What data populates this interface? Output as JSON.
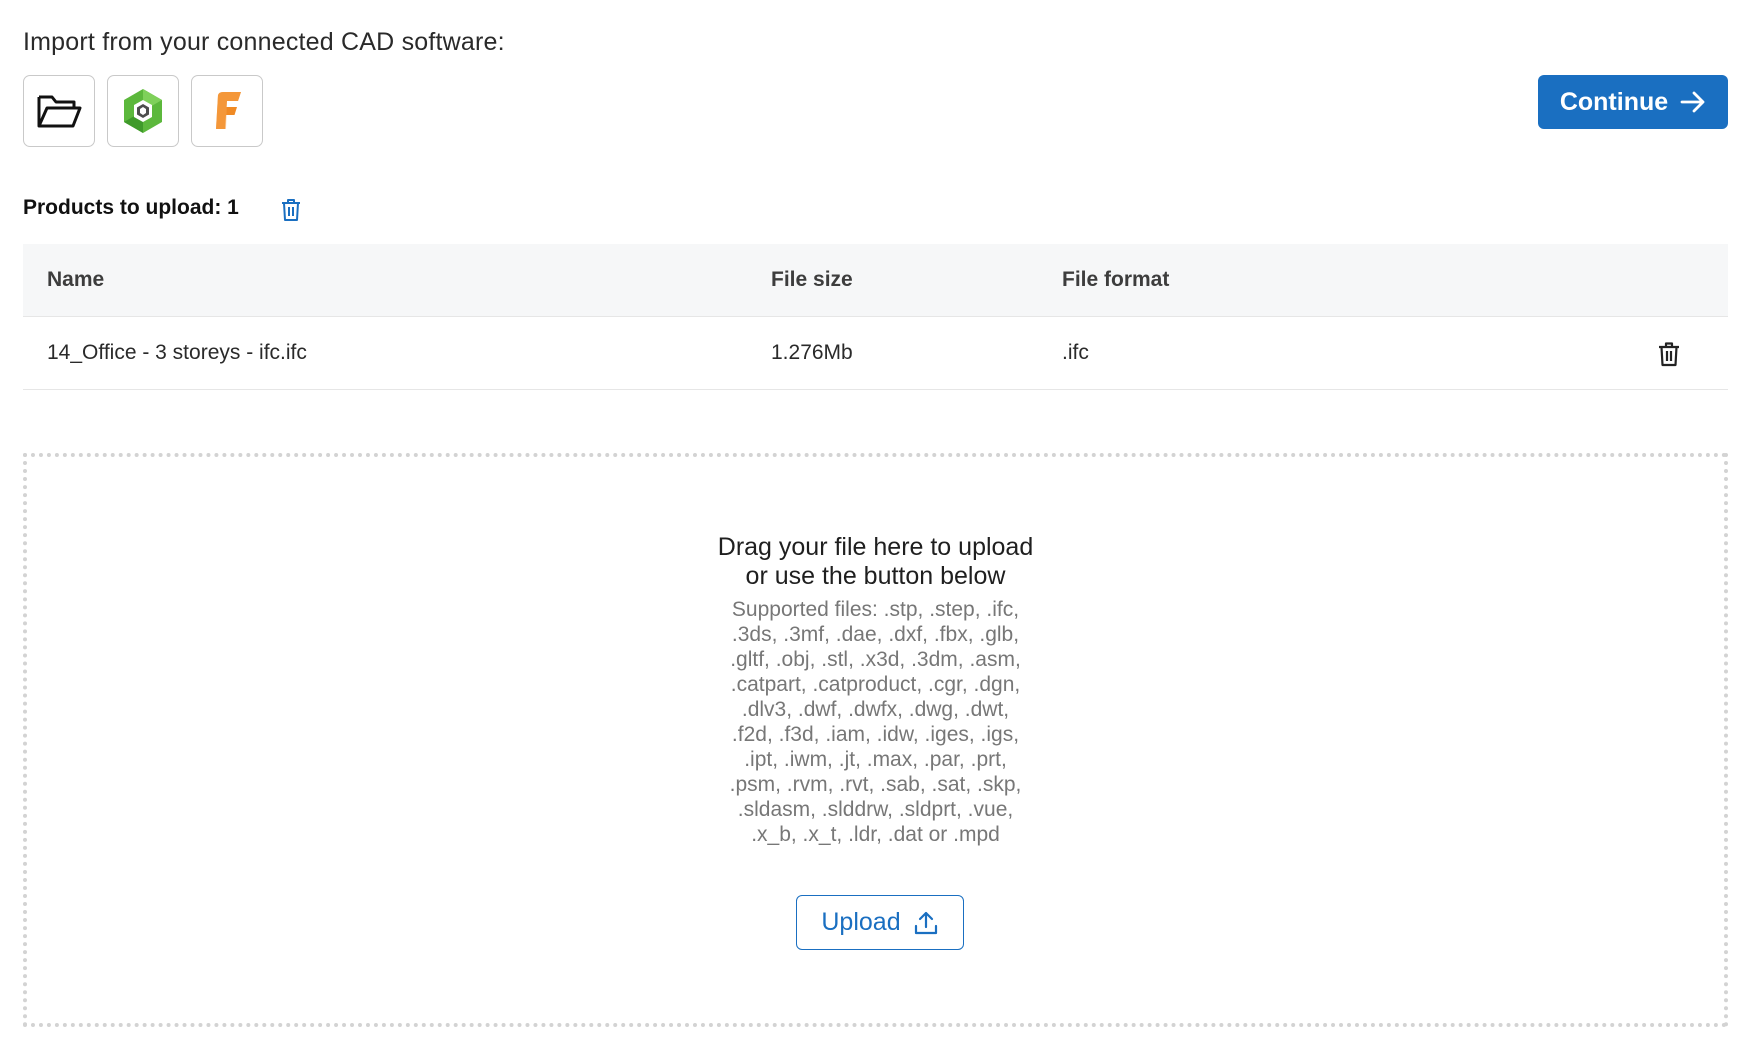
{
  "import": {
    "title": "Import from your connected CAD software:",
    "sources": [
      {
        "icon": "folder-open-icon"
      },
      {
        "icon": "bim-hexagon-logo-icon",
        "color": "#5cb83c"
      },
      {
        "icon": "fusion-f-logo-icon",
        "color": "#f08a24"
      }
    ]
  },
  "continue_button": {
    "label": "Continue",
    "icon": "arrow-right-icon",
    "color": "#1a6fc1"
  },
  "products": {
    "label": "Products to upload: 1"
  },
  "table": {
    "columns": {
      "name": "Name",
      "size": "File size",
      "format": "File format"
    },
    "rows": [
      {
        "name": "14_Office - 3 storeys - ifc.ifc",
        "size": "1.276Mb",
        "format": ".ifc"
      }
    ]
  },
  "dropzone": {
    "line1": "Drag your file here to upload",
    "line2": "or use the button below",
    "supported_lines": [
      "Supported files: .stp, .step, .ifc,",
      ".3ds, .3mf, .dae, .dxf, .fbx, .glb,",
      ".gltf, .obj, .stl, .x3d, .3dm, .asm,",
      ".catpart, .catproduct, .cgr, .dgn,",
      ".dlv3, .dwf, .dwfx, .dwg, .dwt,",
      ".f2d, .f3d, .iam, .idw, .iges, .igs,",
      ".ipt, .iwm, .jt, .max, .par, .prt,",
      ".psm, .rvm, .rvt, .sab, .sat, .skp,",
      ".sldasm, .slddrw, .sldprt, .vue,",
      ".x_b, .x_t, .ldr, .dat or .mpd"
    ],
    "upload_label": "Upload",
    "upload_icon": "upload-icon"
  }
}
